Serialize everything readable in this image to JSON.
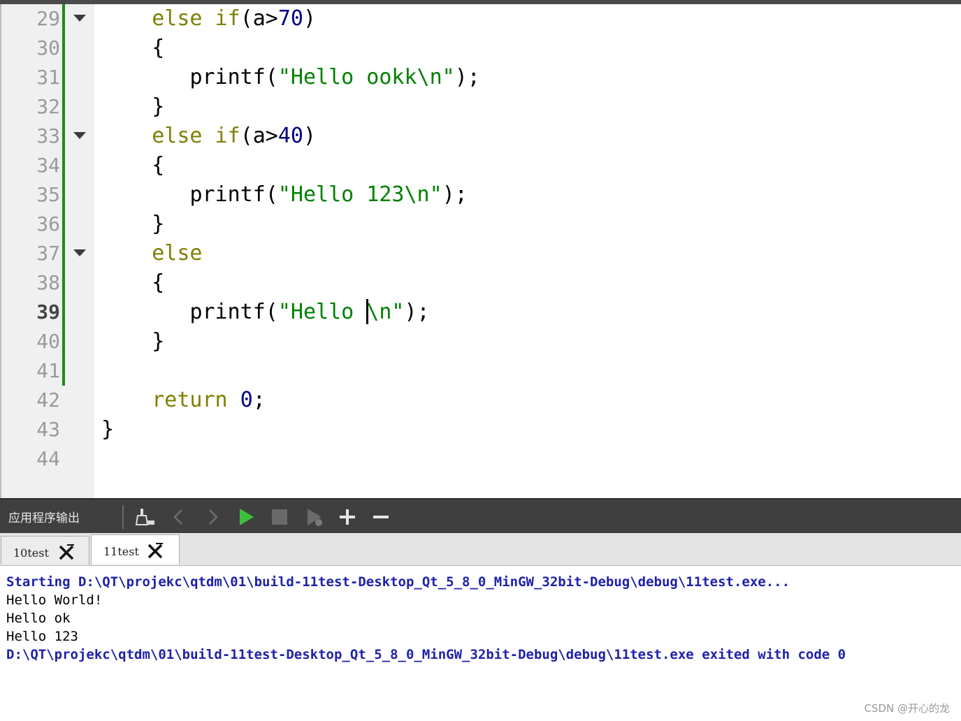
{
  "editor": {
    "lines": [
      {
        "n": "29",
        "fold": true,
        "changed": true,
        "current": false
      },
      {
        "n": "30",
        "fold": false,
        "changed": true,
        "current": false
      },
      {
        "n": "31",
        "fold": false,
        "changed": true,
        "current": false
      },
      {
        "n": "32",
        "fold": false,
        "changed": true,
        "current": false
      },
      {
        "n": "33",
        "fold": true,
        "changed": true,
        "current": false
      },
      {
        "n": "34",
        "fold": false,
        "changed": true,
        "current": false
      },
      {
        "n": "35",
        "fold": false,
        "changed": true,
        "current": false
      },
      {
        "n": "36",
        "fold": false,
        "changed": true,
        "current": false
      },
      {
        "n": "37",
        "fold": true,
        "changed": true,
        "current": false
      },
      {
        "n": "38",
        "fold": false,
        "changed": true,
        "current": false
      },
      {
        "n": "39",
        "fold": false,
        "changed": true,
        "current": true
      },
      {
        "n": "40",
        "fold": false,
        "changed": true,
        "current": false
      },
      {
        "n": "41",
        "fold": false,
        "changed": true,
        "current": false
      },
      {
        "n": "42",
        "fold": false,
        "changed": false,
        "current": false
      },
      {
        "n": "43",
        "fold": false,
        "changed": false,
        "current": false
      },
      {
        "n": "44",
        "fold": false,
        "changed": false,
        "current": false
      }
    ],
    "code": {
      "l29": {
        "indent": "    ",
        "kw": "else if",
        "open": "(a>",
        "num": "70",
        "close": ")"
      },
      "l30": "    {",
      "l31": {
        "indent": "       ",
        "fn": "printf(",
        "str": "\"Hello ookk\\n\"",
        "end": ");"
      },
      "l32": "    }",
      "l33": {
        "indent": "    ",
        "kw": "else if",
        "open": "(a>",
        "num": "40",
        "close": ")"
      },
      "l34": "    {",
      "l35": {
        "indent": "       ",
        "fn": "printf(",
        "str": "\"Hello 123\\n\"",
        "end": ");"
      },
      "l36": "    }",
      "l37": {
        "indent": "    ",
        "kw": "else"
      },
      "l38": "    {",
      "l39": {
        "indent": "       ",
        "fn": "printf(",
        "str_a": "\"Hello ",
        "str_b": "\\n\"",
        "end": ");"
      },
      "l40": "    }",
      "l41": "",
      "l42": {
        "indent": "    ",
        "kw": "return",
        "sp": " ",
        "num": "0",
        "end": ";"
      },
      "l43": "}",
      "l44": ""
    }
  },
  "output_pane": {
    "title": "应用程序输出",
    "toolbar_icons": [
      "clear-output-icon",
      "previous-icon",
      "next-icon",
      "run-icon",
      "stop-icon",
      "debug-run-icon",
      "zoom-in-icon",
      "zoom-out-icon"
    ],
    "tabs": [
      {
        "label": "10test",
        "active": false
      },
      {
        "label": "11test",
        "active": true
      }
    ],
    "lines": [
      {
        "text": "Starting D:\\QT\\projekc\\qtdm\\01\\build-11test-Desktop_Qt_5_8_0_MinGW_32bit-Debug\\debug\\11test.exe...",
        "kind": "info"
      },
      {
        "text": "Hello World!",
        "kind": "plain"
      },
      {
        "text": "Hello ok",
        "kind": "plain"
      },
      {
        "text": "Hello 123",
        "kind": "plain"
      },
      {
        "text": "D:\\QT\\projekc\\qtdm\\01\\build-11test-Desktop_Qt_5_8_0_MinGW_32bit-Debug\\debug\\11test.exe exited with code 0",
        "kind": "info"
      }
    ]
  },
  "watermark": "CSDN @开心的龙",
  "colors": {
    "keyword": "#808000",
    "number": "#000080",
    "string": "#008000",
    "info_text": "#1e22aa",
    "change_bar": "#1f8a1f"
  }
}
